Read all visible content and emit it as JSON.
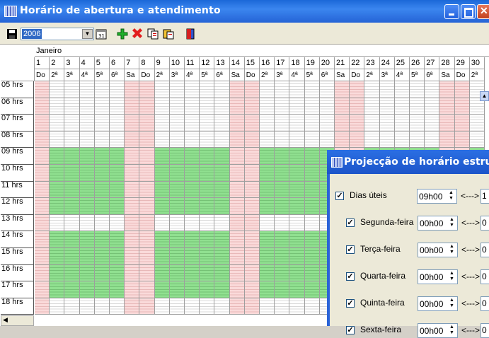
{
  "window": {
    "title": "Horário de abertura e atendimento"
  },
  "toolbar": {
    "year": "2006",
    "icons": [
      "save-icon",
      "calendar-icon",
      "add-icon",
      "delete-icon",
      "copy-icon",
      "paste-icon",
      "exit-icon"
    ]
  },
  "grid": {
    "month": "Janeiro",
    "days": [
      "1",
      "2",
      "3",
      "4",
      "5",
      "6",
      "7",
      "8",
      "9",
      "10",
      "11",
      "12",
      "13",
      "14",
      "15",
      "16",
      "17",
      "18",
      "19",
      "20",
      "21",
      "22",
      "23",
      "24",
      "25",
      "26",
      "27",
      "28",
      "29",
      "30"
    ],
    "weekdays": [
      "Do",
      "2ª",
      "3ª",
      "4ª",
      "5ª",
      "6ª",
      "Sa",
      "Do",
      "2ª",
      "3ª",
      "4ª",
      "5ª",
      "6ª",
      "Sa",
      "Do",
      "2ª",
      "3ª",
      "4ª",
      "5ª",
      "6ª",
      "Sa",
      "Do",
      "2ª",
      "3ª",
      "4ª",
      "5ª",
      "6ª",
      "Sa",
      "Do",
      "2ª"
    ],
    "hours": [
      "05 hrs",
      "06 hrs",
      "07 hrs",
      "08 hrs",
      "09 hrs",
      "10 hrs",
      "11 hrs",
      "12 hrs",
      "13 hrs",
      "14 hrs",
      "15 hrs",
      "16 hrs",
      "17 hrs",
      "18 hrs"
    ],
    "colors": {
      "weekend": "#fadada",
      "open": "#90e090",
      "line": "#9e9e9e"
    }
  },
  "dialog": {
    "title": "Projecção de horário estrutur",
    "rows": [
      {
        "label": "Dias úteis",
        "from": "09h00",
        "sep": "<--->",
        "to": "1",
        "checked": true
      },
      {
        "label": "Segunda-feira",
        "from": "00h00",
        "sep": "<--->",
        "to": "0",
        "checked": true
      },
      {
        "label": "Terça-feira",
        "from": "00h00",
        "sep": "<--->",
        "to": "0",
        "checked": true
      },
      {
        "label": "Quarta-feira",
        "from": "00h00",
        "sep": "<--->",
        "to": "0",
        "checked": true
      },
      {
        "label": "Quinta-feira",
        "from": "00h00",
        "sep": "<--->",
        "to": "0",
        "checked": true
      },
      {
        "label": "Sexta-feira",
        "from": "00h00",
        "sep": "<--->",
        "to": "0",
        "checked": true
      }
    ]
  }
}
